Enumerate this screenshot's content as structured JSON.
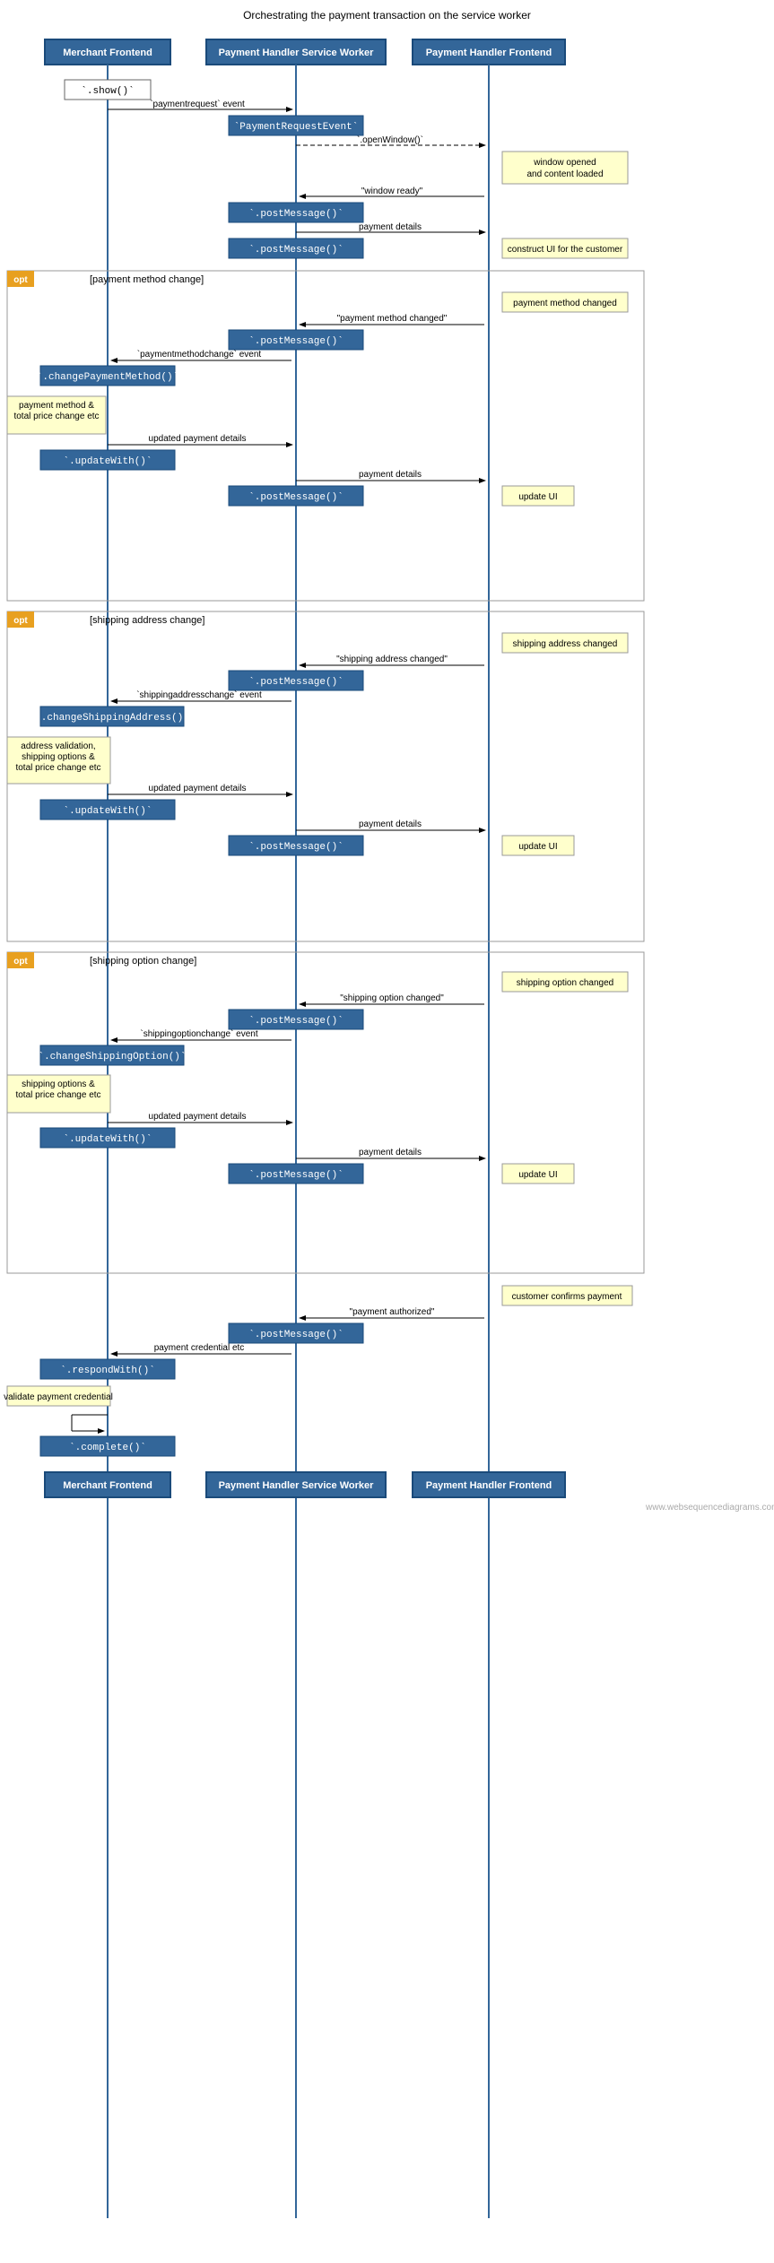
{
  "title": "Orchestrating the payment transaction on the service worker",
  "lifelines": {
    "merchant": "Merchant Frontend",
    "serviceWorker": "Payment Handler Service Worker",
    "handlerFrontend": "Payment Handler Frontend"
  },
  "watermark": "www.websequencediagrams.com",
  "colors": {
    "lifelineHeader": "#336699",
    "lifelineHeaderBorder": "#1a4a7a",
    "lifelineHeaderText": "#ffffff",
    "optBg": "#fffbe6",
    "optBorder": "#999999",
    "optLabel": "#e8a020",
    "arrowColor": "#000000",
    "methodBox": "#336699",
    "noteBox": "#ffffcc",
    "noteBorder": "#999999",
    "actorBox": "#eeeeee"
  }
}
